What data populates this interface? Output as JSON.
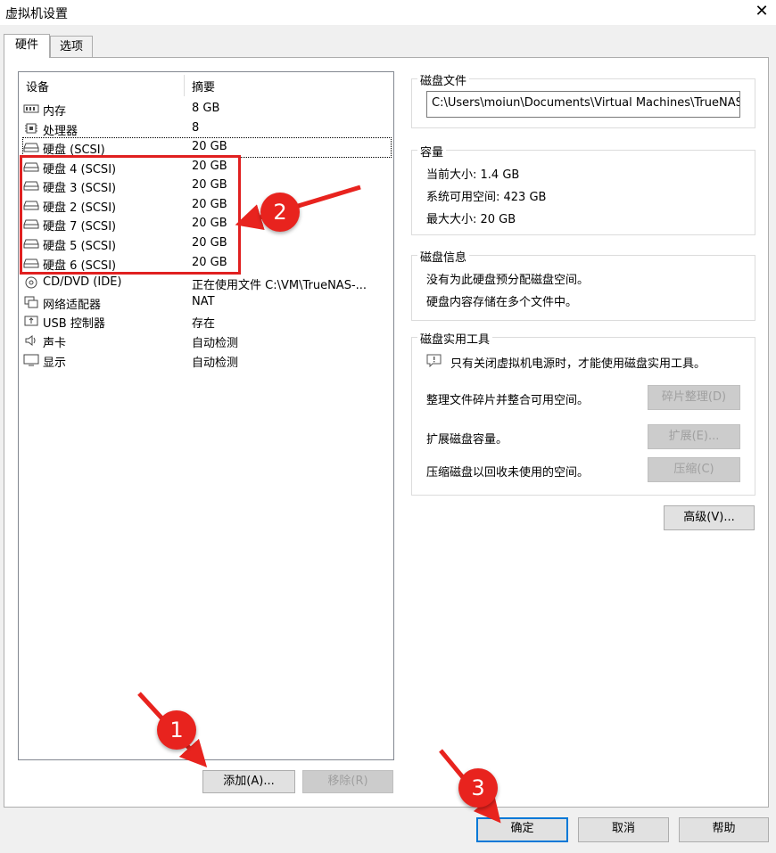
{
  "window": {
    "title": "虚拟机设置"
  },
  "tabs": [
    "硬件",
    "选项"
  ],
  "device_list": {
    "columns": [
      "设备",
      "摘要"
    ],
    "rows": [
      {
        "name": "内存",
        "summary": "8 GB",
        "icon": "memory-icon"
      },
      {
        "name": "处理器",
        "summary": "8",
        "icon": "cpu-icon"
      },
      {
        "name": "硬盘 (SCSI)",
        "summary": "20 GB",
        "icon": "disk-icon"
      },
      {
        "name": "硬盘 4 (SCSI)",
        "summary": "20 GB",
        "icon": "disk-icon"
      },
      {
        "name": "硬盘 3 (SCSI)",
        "summary": "20 GB",
        "icon": "disk-icon"
      },
      {
        "name": "硬盘 2 (SCSI)",
        "summary": "20 GB",
        "icon": "disk-icon"
      },
      {
        "name": "硬盘 7 (SCSI)",
        "summary": "20 GB",
        "icon": "disk-icon"
      },
      {
        "name": "硬盘 5 (SCSI)",
        "summary": "20 GB",
        "icon": "disk-icon"
      },
      {
        "name": "硬盘 6 (SCSI)",
        "summary": "20 GB",
        "icon": "disk-icon"
      },
      {
        "name": "CD/DVD (IDE)",
        "summary": "正在使用文件 C:\\VM\\TrueNAS-...",
        "icon": "cd-icon"
      },
      {
        "name": "网络适配器",
        "summary": "NAT",
        "icon": "network-icon"
      },
      {
        "name": "USB 控制器",
        "summary": "存在",
        "icon": "usb-icon"
      },
      {
        "name": "声卡",
        "summary": "自动检测",
        "icon": "speaker-icon"
      },
      {
        "name": "显示",
        "summary": "自动检测",
        "icon": "monitor-icon"
      }
    ]
  },
  "list_buttons": {
    "add": "添加(A)...",
    "remove": "移除(R)"
  },
  "disk_file": {
    "label": "磁盘文件",
    "path": "C:\\Users\\moiun\\Documents\\Virtual Machines\\TrueNAS"
  },
  "capacity": {
    "label": "容量",
    "current": "当前大小: 1.4 GB",
    "available": "系统可用空间: 423 GB",
    "max": "最大大小: 20 GB"
  },
  "disk_info": {
    "label": "磁盘信息",
    "line1": "没有为此硬盘预分配磁盘空间。",
    "line2": "硬盘内容存储在多个文件中。"
  },
  "disk_utils": {
    "label": "磁盘实用工具",
    "note": "只有关闭虚拟机电源时，才能使用磁盘实用工具。",
    "defrag_text": "整理文件碎片并整合可用空间。",
    "defrag_btn": "碎片整理(D)",
    "expand_text": "扩展磁盘容量。",
    "expand_btn": "扩展(E)...",
    "compact_text": "压缩磁盘以回收未使用的空间。",
    "compact_btn": "压缩(C)"
  },
  "advanced_btn": "高级(V)...",
  "dialog_buttons": {
    "ok": "确定",
    "cancel": "取消",
    "help": "帮助"
  },
  "annotations": [
    "1",
    "2",
    "3"
  ],
  "colors": {
    "callout": "#e8231e",
    "highlight_box": "#e02020",
    "primary_border": "#0078d7"
  }
}
